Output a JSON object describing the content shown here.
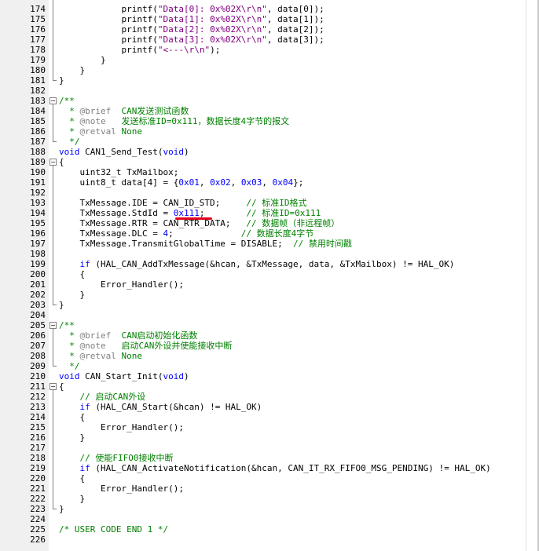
{
  "editor": {
    "lines": [
      {
        "num": "174",
        "segs": [
          [
            "            printf(",
            ""
          ],
          [
            "\"Data[0]: 0x%02X\\r\\n\"",
            "str"
          ],
          [
            ", data[0]);",
            ""
          ]
        ]
      },
      {
        "num": "175",
        "segs": [
          [
            "            printf(",
            ""
          ],
          [
            "\"Data[1]: 0x%02X\\r\\n\"",
            "str"
          ],
          [
            ", data[1]);",
            ""
          ]
        ]
      },
      {
        "num": "176",
        "segs": [
          [
            "            printf(",
            ""
          ],
          [
            "\"Data[2]: 0x%02X\\r\\n\"",
            "str"
          ],
          [
            ", data[2]);",
            ""
          ]
        ]
      },
      {
        "num": "177",
        "segs": [
          [
            "            printf(",
            ""
          ],
          [
            "\"Data[3]: 0x%02X\\r\\n\"",
            "str"
          ],
          [
            ", data[3]);",
            ""
          ]
        ]
      },
      {
        "num": "178",
        "segs": [
          [
            "            printf(",
            ""
          ],
          [
            "\"<---\\r\\n\"",
            "str"
          ],
          [
            ");",
            ""
          ]
        ]
      },
      {
        "num": "179",
        "segs": [
          [
            "        }",
            ""
          ]
        ]
      },
      {
        "num": "180",
        "segs": [
          [
            "    }",
            ""
          ]
        ]
      },
      {
        "num": "181",
        "segs": [
          [
            "}",
            ""
          ]
        ]
      },
      {
        "num": "182",
        "segs": []
      },
      {
        "num": "183",
        "segs": [
          [
            "/**",
            "com"
          ]
        ]
      },
      {
        "num": "184",
        "segs": [
          [
            "  * ",
            "com"
          ],
          [
            "@brief",
            "tag"
          ],
          [
            "  CAN发送测试函数",
            "com"
          ]
        ]
      },
      {
        "num": "185",
        "segs": [
          [
            "  * ",
            "com"
          ],
          [
            "@note",
            "tag"
          ],
          [
            "   发送标准ID=0x111，数据长度4字节的报文",
            "com"
          ]
        ]
      },
      {
        "num": "186",
        "segs": [
          [
            "  * ",
            "com"
          ],
          [
            "@retval",
            "tag"
          ],
          [
            " None",
            "com"
          ]
        ]
      },
      {
        "num": "187",
        "segs": [
          [
            "  */",
            "com"
          ]
        ]
      },
      {
        "num": "188",
        "segs": [
          [
            "void",
            "kw"
          ],
          [
            " CAN1_Send_Test(",
            ""
          ],
          [
            "void",
            "kw"
          ],
          [
            ")",
            ""
          ]
        ]
      },
      {
        "num": "189",
        "segs": [
          [
            "{",
            ""
          ]
        ]
      },
      {
        "num": "190",
        "segs": [
          [
            "    uint32_t TxMailbox;",
            ""
          ]
        ]
      },
      {
        "num": "191",
        "segs": [
          [
            "    uint8_t data[4] = {",
            ""
          ],
          [
            "0x01",
            "num"
          ],
          [
            ", ",
            ""
          ],
          [
            "0x02",
            "num"
          ],
          [
            ", ",
            ""
          ],
          [
            "0x03",
            "num"
          ],
          [
            ", ",
            ""
          ],
          [
            "0x04",
            "num"
          ],
          [
            "};",
            ""
          ]
        ]
      },
      {
        "num": "192",
        "segs": []
      },
      {
        "num": "193",
        "segs": [
          [
            "    TxMessage.IDE = CAN_ID_STD;     ",
            ""
          ],
          [
            "// 标准ID格式",
            "com"
          ]
        ]
      },
      {
        "num": "194",
        "segs": [
          [
            "    TxMessage.StdId = ",
            ""
          ],
          [
            "0x111",
            "num"
          ],
          [
            ";        ",
            ""
          ],
          [
            "// 标准ID=0x111",
            "com"
          ]
        ]
      },
      {
        "num": "195",
        "segs": [
          [
            "    TxMessage.RTR = CAN_RTR_DATA;   ",
            ""
          ],
          [
            "// 数据帧（非远程帧）",
            "com"
          ]
        ]
      },
      {
        "num": "196",
        "segs": [
          [
            "    TxMessage.DLC = ",
            ""
          ],
          [
            "4",
            "num"
          ],
          [
            ";             ",
            ""
          ],
          [
            "// 数据长度4字节",
            "com"
          ]
        ]
      },
      {
        "num": "197",
        "segs": [
          [
            "    TxMessage.TransmitGlobalTime = DISABLE;  ",
            ""
          ],
          [
            "// 禁用时间戳",
            "com"
          ]
        ]
      },
      {
        "num": "198",
        "segs": []
      },
      {
        "num": "199",
        "segs": [
          [
            "    ",
            ""
          ],
          [
            "if",
            "kw"
          ],
          [
            " (HAL_CAN_AddTxMessage(&hcan, &TxMessage, data, &TxMailbox) != HAL_OK)",
            ""
          ]
        ]
      },
      {
        "num": "200",
        "segs": [
          [
            "    {",
            ""
          ]
        ]
      },
      {
        "num": "201",
        "segs": [
          [
            "        Error_Handler();",
            ""
          ]
        ]
      },
      {
        "num": "202",
        "segs": [
          [
            "    }",
            ""
          ]
        ]
      },
      {
        "num": "203",
        "segs": [
          [
            "}",
            ""
          ]
        ]
      },
      {
        "num": "204",
        "segs": []
      },
      {
        "num": "205",
        "segs": [
          [
            "/**",
            "com"
          ]
        ]
      },
      {
        "num": "206",
        "segs": [
          [
            "  * ",
            "com"
          ],
          [
            "@brief",
            "tag"
          ],
          [
            "  CAN启动初始化函数",
            "com"
          ]
        ]
      },
      {
        "num": "207",
        "segs": [
          [
            "  * ",
            "com"
          ],
          [
            "@note",
            "tag"
          ],
          [
            "   启动CAN外设并使能接收中断",
            "com"
          ]
        ]
      },
      {
        "num": "208",
        "segs": [
          [
            "  * ",
            "com"
          ],
          [
            "@retval",
            "tag"
          ],
          [
            " None",
            "com"
          ]
        ]
      },
      {
        "num": "209",
        "segs": [
          [
            "  */",
            "com"
          ]
        ]
      },
      {
        "num": "210",
        "segs": [
          [
            "void",
            "kw"
          ],
          [
            " CAN_Start_Init(",
            ""
          ],
          [
            "void",
            "kw"
          ],
          [
            ")",
            ""
          ]
        ]
      },
      {
        "num": "211",
        "segs": [
          [
            "{",
            ""
          ]
        ]
      },
      {
        "num": "212",
        "segs": [
          [
            "    ",
            ""
          ],
          [
            "// 启动CAN外设",
            "com"
          ]
        ]
      },
      {
        "num": "213",
        "segs": [
          [
            "    ",
            ""
          ],
          [
            "if",
            "kw"
          ],
          [
            " (HAL_CAN_Start(&hcan) != HAL_OK)",
            ""
          ]
        ]
      },
      {
        "num": "214",
        "segs": [
          [
            "    {",
            ""
          ]
        ]
      },
      {
        "num": "215",
        "segs": [
          [
            "        Error_Handler();",
            ""
          ]
        ]
      },
      {
        "num": "216",
        "segs": [
          [
            "    }",
            ""
          ]
        ]
      },
      {
        "num": "217",
        "segs": []
      },
      {
        "num": "218",
        "segs": [
          [
            "    ",
            ""
          ],
          [
            "// 使能FIFO0接收中断",
            "com"
          ]
        ]
      },
      {
        "num": "219",
        "segs": [
          [
            "    ",
            ""
          ],
          [
            "if",
            "kw"
          ],
          [
            " (HAL_CAN_ActivateNotification(&hcan, CAN_IT_RX_FIFO0_MSG_PENDING) != HAL_OK)",
            ""
          ]
        ]
      },
      {
        "num": "220",
        "segs": [
          [
            "    {",
            ""
          ]
        ]
      },
      {
        "num": "221",
        "segs": [
          [
            "        Error_Handler();",
            ""
          ]
        ]
      },
      {
        "num": "222",
        "segs": [
          [
            "    }",
            ""
          ]
        ]
      },
      {
        "num": "223",
        "segs": [
          [
            "}",
            ""
          ]
        ]
      },
      {
        "num": "224",
        "segs": []
      },
      {
        "num": "225",
        "segs": [
          [
            "/* USER CODE END 1 */",
            "com"
          ]
        ]
      },
      {
        "num": "226",
        "segs": []
      }
    ],
    "fold_markers": [
      "183",
      "189",
      "205",
      "211"
    ],
    "fold_symbol": "−",
    "colors": {
      "keyword": "#0000ff",
      "string": "#800080",
      "number": "#0000ff",
      "comment": "#008000",
      "doc_tag": "#808080",
      "annotation_underline": "#e0001b",
      "gutter_bg": "#f0f0f0"
    }
  }
}
